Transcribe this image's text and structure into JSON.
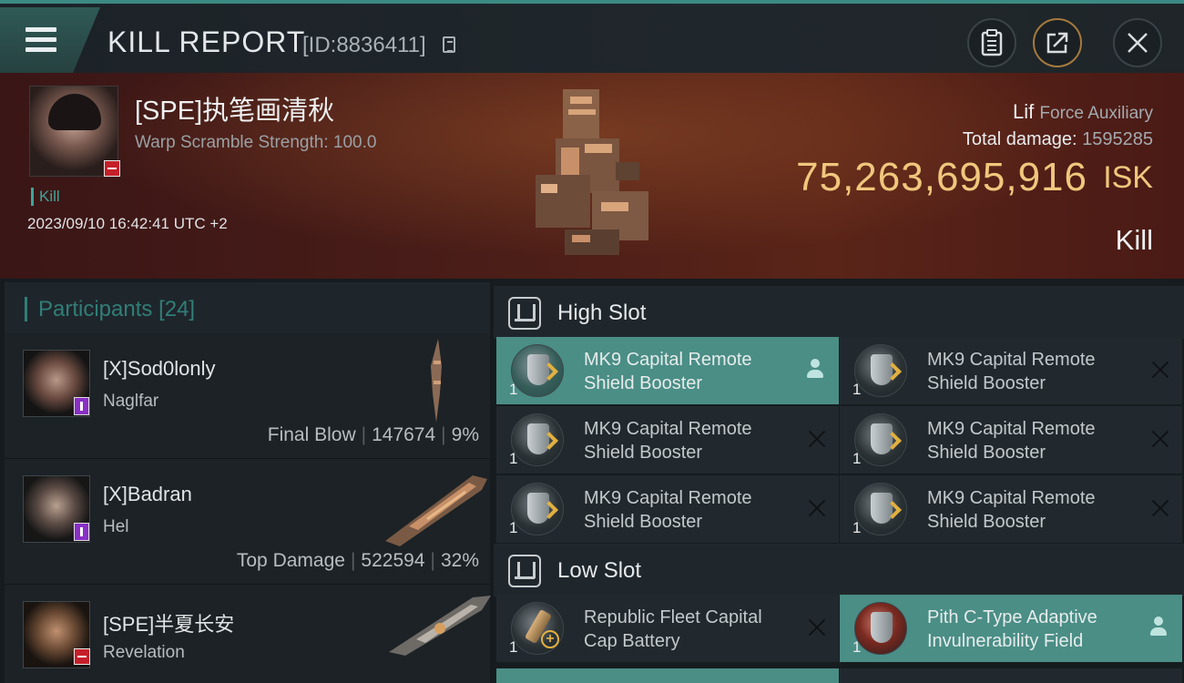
{
  "header": {
    "title": "KILL REPORT",
    "report_id": "[ID:8836411]"
  },
  "victim": {
    "name": "[SPE]执笔画清秋",
    "subtitle": "Warp Scramble Strength: 100.0",
    "tag": "Kill",
    "timestamp": "2023/09/10 16:42:41 UTC +2",
    "ship_name": "Lif",
    "ship_class": "Force Auxiliary",
    "total_damage_label": "Total damage:",
    "total_damage": "1595285",
    "isk_value": "75,263,695,916",
    "isk_unit": "ISK",
    "result": "Kill"
  },
  "participants": {
    "label": "Participants",
    "count": "[24]",
    "items": [
      {
        "name": "[X]Sod0lonly",
        "ship": "Naglfar",
        "role": "Final Blow",
        "damage": "147674",
        "percent": "9%",
        "badge": "purple"
      },
      {
        "name": "[X]Badran",
        "ship": "Hel",
        "role": "Top Damage",
        "damage": "522594",
        "percent": "32%",
        "badge": "purple"
      },
      {
        "name": "[SPE]半夏长安",
        "ship": "Revelation",
        "role": "",
        "damage": "",
        "percent": "",
        "badge": "red"
      }
    ]
  },
  "slots": {
    "high": {
      "label": "High Slot",
      "modules": [
        {
          "qty": "1",
          "name": "MK9 Capital Remote Shield Booster",
          "status": "selected"
        },
        {
          "qty": "1",
          "name": "MK9 Capital Remote Shield Booster",
          "status": "destroyed"
        },
        {
          "qty": "1",
          "name": "MK9 Capital Remote Shield Booster",
          "status": "destroyed"
        },
        {
          "qty": "1",
          "name": "MK9 Capital Remote Shield Booster",
          "status": "destroyed"
        },
        {
          "qty": "1",
          "name": "MK9 Capital Remote Shield Booster",
          "status": "destroyed"
        },
        {
          "qty": "1",
          "name": "MK9 Capital Remote Shield Booster",
          "status": "destroyed"
        }
      ]
    },
    "low": {
      "label": "Low Slot",
      "modules": [
        {
          "qty": "1",
          "name": "Republic Fleet Capital Cap Battery",
          "status": "destroyed"
        },
        {
          "qty": "1",
          "name": "Pith C-Type Adaptive Invulnerability Field",
          "status": "selected"
        }
      ]
    }
  },
  "icons": {
    "menu": "hamburger-menu-icon",
    "copy": "copy-icon",
    "clipboard": "clipboard-icon",
    "share": "share-icon",
    "close": "close-icon",
    "slot": "slot-icon",
    "dropped": "person-icon",
    "destroyed": "x-icon"
  },
  "colors": {
    "accent": "#3b8a84",
    "isk": "#f0c77d",
    "selected_module": "#4a8e86",
    "badge_red": "#c5202a",
    "badge_purple": "#8a2fc6"
  }
}
